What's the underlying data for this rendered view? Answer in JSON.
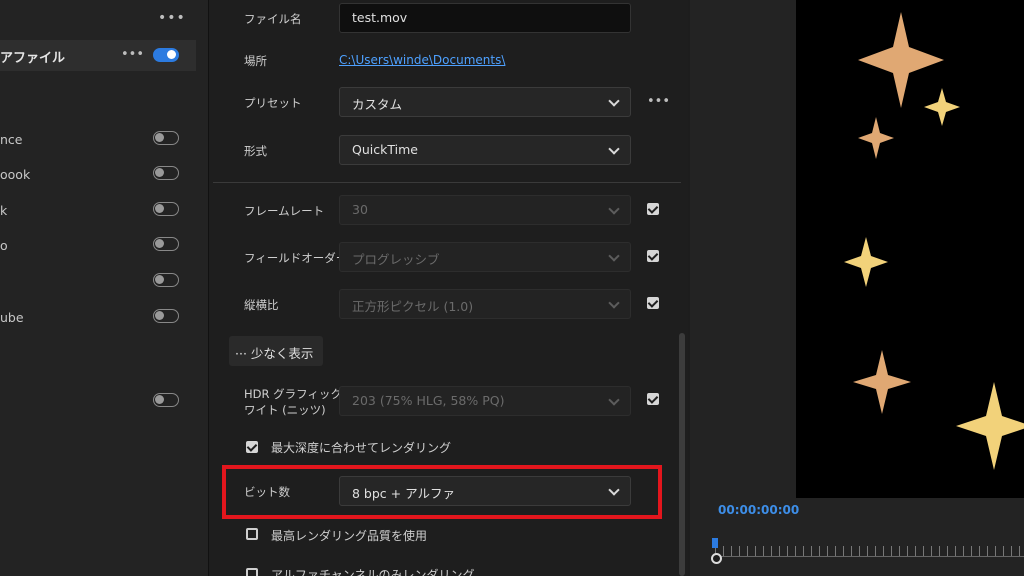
{
  "left_panel": {
    "more_label": "•••",
    "selected": {
      "label": "アファイル",
      "more_label": "•••",
      "toggle_on": true
    },
    "presets": [
      {
        "label": "nce",
        "toggle_on": false
      },
      {
        "label": "oook",
        "toggle_on": false
      },
      {
        "label": "k",
        "toggle_on": false
      },
      {
        "label": "o",
        "toggle_on": false
      },
      {
        "label": "",
        "toggle_on": false
      },
      {
        "label": "ube",
        "toggle_on": false
      },
      {
        "label": "",
        "toggle_on": false
      }
    ]
  },
  "settings": {
    "filename": {
      "label": "ファイル名",
      "value": "test.mov"
    },
    "location": {
      "label": "場所",
      "value": "C:\\Users\\winde\\Documents\\"
    },
    "preset": {
      "label": "プリセット",
      "value": "カスタム",
      "more_label": "•••"
    },
    "format": {
      "label": "形式",
      "value": "QuickTime"
    },
    "frame_rate": {
      "label": "フレームレート",
      "value": "30",
      "checked": true
    },
    "field_order": {
      "label": "フィールドオーダー",
      "value": "プログレッシブ",
      "checked": true
    },
    "aspect": {
      "label": "縦横比",
      "value": "正方形ピクセル (1.0)",
      "checked": true
    },
    "show_less": "··· 少なく表示",
    "hdr": {
      "label_line1": "HDR グラフィックホ",
      "label_line2": "ワイト (ニッツ)",
      "value": "203 (75% HLG, 58% PQ)",
      "checked": true
    },
    "max_depth": {
      "label": "最大深度に合わせてレンダリング",
      "checked": true
    },
    "bit_depth": {
      "label": "ビット数",
      "value": "8 bpc + アルファ"
    },
    "max_quality": {
      "label": "最高レンダリング品質を使用",
      "checked": false
    },
    "alpha_only": {
      "label": "アルファチャンネルのみレンダリング",
      "checked": false
    }
  },
  "preview": {
    "timecode": "00:00:00:00",
    "star_colors": [
      "#e0a873",
      "#f2d27a"
    ]
  }
}
